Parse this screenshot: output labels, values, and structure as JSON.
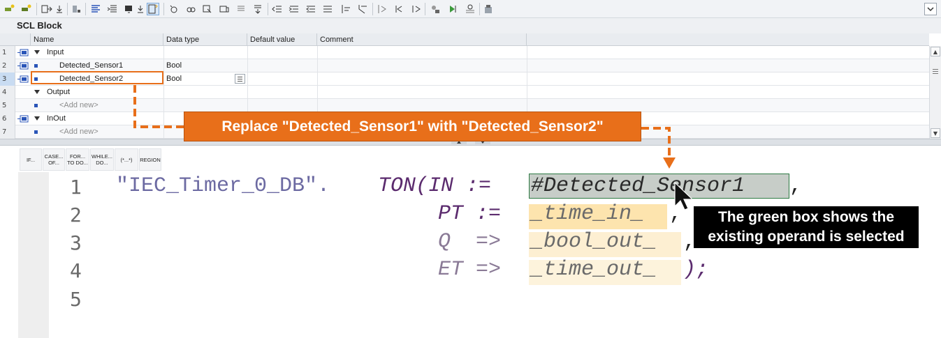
{
  "toolbar": {
    "icons": [
      "insert-network-icon",
      "insert-network-icon",
      "insert-output-icon",
      "open-branch-icon",
      "close-branch-icon",
      "insert-input-icon",
      "insert-output-icon",
      "download-icon",
      "go-online-icon",
      "comment-icon",
      "uncomment-icon",
      "indent-icon",
      "outdent-icon",
      "toggle-icon",
      "expand-icon",
      "collapse-icon",
      "bookmark-icon",
      "previous-bookmark-icon",
      "next-bookmark-icon",
      "breakpoint-icon",
      "step-icon",
      "step-over-icon",
      "step-out-icon",
      "monitor-icon",
      "watch-icon",
      "compare-icon",
      "memory-icon"
    ],
    "active_icon": "absolute-operand-icon"
  },
  "block": {
    "title": "SCL Block"
  },
  "interface_table": {
    "columns": [
      "Name",
      "Data type",
      "Default value",
      "Comment"
    ],
    "rows": [
      {
        "num": "1",
        "name": "Input",
        "type": "",
        "kind": "section"
      },
      {
        "num": "2",
        "name": "Detected_Sensor1",
        "type": "Bool",
        "kind": "var"
      },
      {
        "num": "3",
        "name": "Detected_Sensor2",
        "type": "Bool",
        "kind": "var"
      },
      {
        "num": "4",
        "name": "Output",
        "type": "",
        "kind": "section"
      },
      {
        "num": "5",
        "name": "<Add new>",
        "type": "",
        "kind": "new"
      },
      {
        "num": "6",
        "name": "InOut",
        "type": "",
        "kind": "section"
      },
      {
        "num": "7",
        "name": "<Add new>",
        "type": "",
        "kind": "new"
      }
    ]
  },
  "instructions": [
    "IF...",
    "CASE... OF...",
    "FOR... TO DO...",
    "WHILE... DO...",
    "(*...*)",
    "REGION"
  ],
  "code": {
    "line_numbers": [
      "1",
      "2",
      "3",
      "4",
      "5"
    ],
    "line1_prefix": "\"IEC_Timer_0_DB\".",
    "line1_kw": "TON(IN :=",
    "line1_operand": "#Detected_Sensor1",
    "line1_end": ",",
    "line2_kw": "PT :=",
    "line2_operand": "_time_in_",
    "line2_end": ",",
    "line3_kw": "Q  =>",
    "line3_operand": "_bool_out_",
    "line3_end": ",",
    "line4_kw": "ET =>",
    "line4_operand": "_time_out_",
    "line4_end": ");"
  },
  "annotations": {
    "replace_callout": "Replace \"Detected_Sensor1\" with \"Detected_Sensor2\"",
    "green_box_line1": "The green box shows the",
    "green_box_line2": "existing operand is selected",
    "orange": "#e86f1a"
  }
}
